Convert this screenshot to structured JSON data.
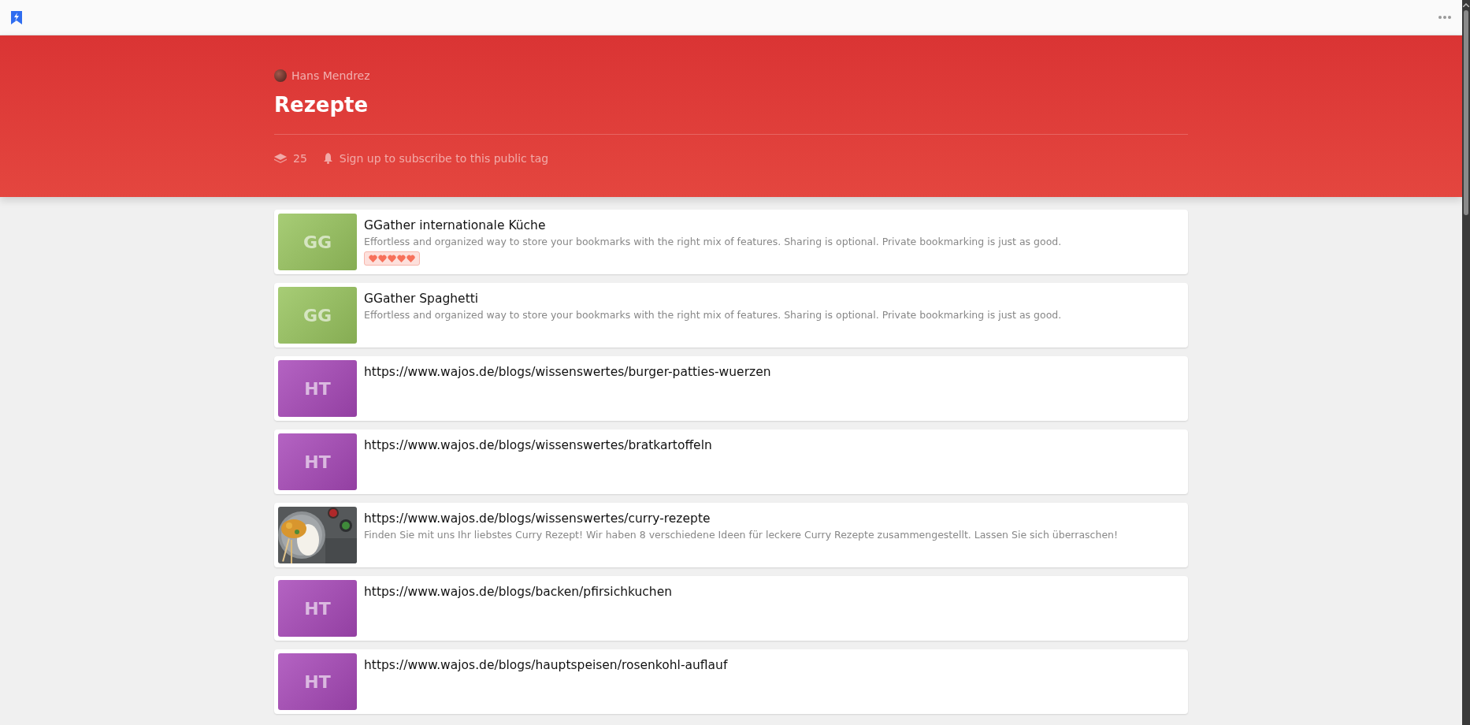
{
  "header": {
    "author": "Hans Mendrez",
    "title": "Rezepte",
    "count": "25",
    "subscribe": "Sign up to subscribe to this public tag"
  },
  "bookmarks": [
    {
      "kind": "initials",
      "initials": "GG",
      "color": "#98c45e",
      "title": "GGather internationale Küche",
      "description": "Effortless and organized way to store your bookmarks with the right mix of features. Sharing is optional. Private bookmarking is just as good.",
      "stars": 5
    },
    {
      "kind": "initials",
      "initials": "GG",
      "color": "#98c45e",
      "title": "GGather Spaghetti",
      "description": "Effortless and organized way to store your bookmarks with the right mix of features. Sharing is optional. Private bookmarking is just as good."
    },
    {
      "kind": "initials",
      "initials": "HT",
      "color": "#a748b8",
      "title": "https://www.wajos.de/blogs/wissenswertes/burger-patties-wuerzen"
    },
    {
      "kind": "initials",
      "initials": "HT",
      "color": "#a748b8",
      "title": "https://www.wajos.de/blogs/wissenswertes/bratkartoffeln"
    },
    {
      "kind": "picture",
      "title": "https://www.wajos.de/blogs/wissenswertes/curry-rezepte",
      "description": "Finden Sie mit uns Ihr liebstes Curry Rezept! Wir haben 8 verschiedene Ideen für leckere Curry Rezepte zusammengestellt. Lassen Sie sich überraschen!"
    },
    {
      "kind": "initials",
      "initials": "HT",
      "color": "#a748b8",
      "title": "https://www.wajos.de/blogs/backen/pfirsichkuchen"
    },
    {
      "kind": "initials",
      "initials": "HT",
      "color": "#a748b8",
      "title": "https://www.wajos.de/blogs/hauptspeisen/rosenkohl-auflauf"
    }
  ]
}
